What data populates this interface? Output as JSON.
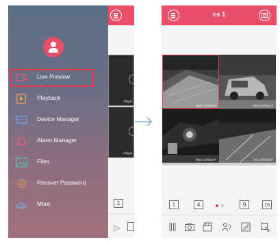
{
  "drawer": {
    "items": [
      {
        "label": "Live Preview",
        "icon": "live-preview-icon",
        "active": true
      },
      {
        "label": "Playback",
        "icon": "playback-icon"
      },
      {
        "label": "Device Manager",
        "icon": "device-manager-icon"
      },
      {
        "label": "Alarm Manager",
        "icon": "alarm-bell-icon"
      },
      {
        "label": "Files",
        "icon": "files-image-icon"
      },
      {
        "label": "Recover Password",
        "icon": "recover-gear-icon"
      },
      {
        "label": "More",
        "icon": "more-cloud-icon"
      }
    ]
  },
  "peek": {
    "tile_label": "Playe",
    "tile_label_2": "Playe",
    "page_button": "1"
  },
  "header": {
    "title": "cs 1"
  },
  "tiles": [
    {
      "stamp": "45ps 15Kbps P"
    },
    {
      "stamp": "49ps 15Kbps P"
    },
    {
      "stamp": "45ps 15Kbps P"
    },
    {
      "stamp": "7fps 25Kbps P"
    }
  ],
  "paginator": {
    "btn_1": "1",
    "btn_4": "4",
    "btn_9": "9",
    "btn_16": "16"
  },
  "colors": {
    "accent": "#ea4f6a",
    "highlight": "#e53a50"
  }
}
